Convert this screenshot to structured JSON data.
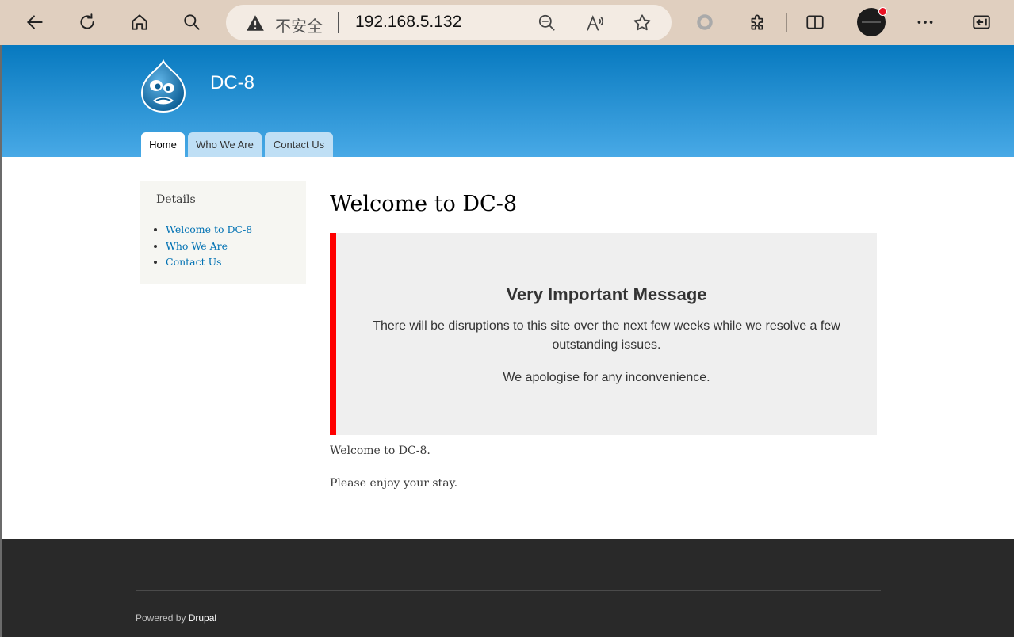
{
  "browser": {
    "security_label": "不安全",
    "url": "192.168.5.132"
  },
  "site": {
    "name": "DC-8",
    "tabs": [
      {
        "label": "Home",
        "active": true
      },
      {
        "label": "Who We Are",
        "active": false
      },
      {
        "label": "Contact Us",
        "active": false
      }
    ]
  },
  "sidebar": {
    "title": "Details",
    "links": [
      "Welcome to DC-8",
      "Who We Are",
      "Contact Us"
    ]
  },
  "main": {
    "title": "Welcome to DC-8",
    "message": {
      "heading": "Very Important Message",
      "line1": "There will be disruptions to this site over the next few weeks while we resolve a few outstanding issues.",
      "line2": "We apologise for any inconvenience."
    },
    "paragraphs": [
      "Welcome to DC-8.",
      "Please enjoy your stay."
    ]
  },
  "footer": {
    "powered_prefix": "Powered by",
    "powered_link": "Drupal"
  },
  "colors": {
    "header_top": "#0779bf",
    "header_bottom": "#48a9e6",
    "link": "#0071b3",
    "message_border": "#ff0000",
    "footer_bg": "#292929"
  }
}
